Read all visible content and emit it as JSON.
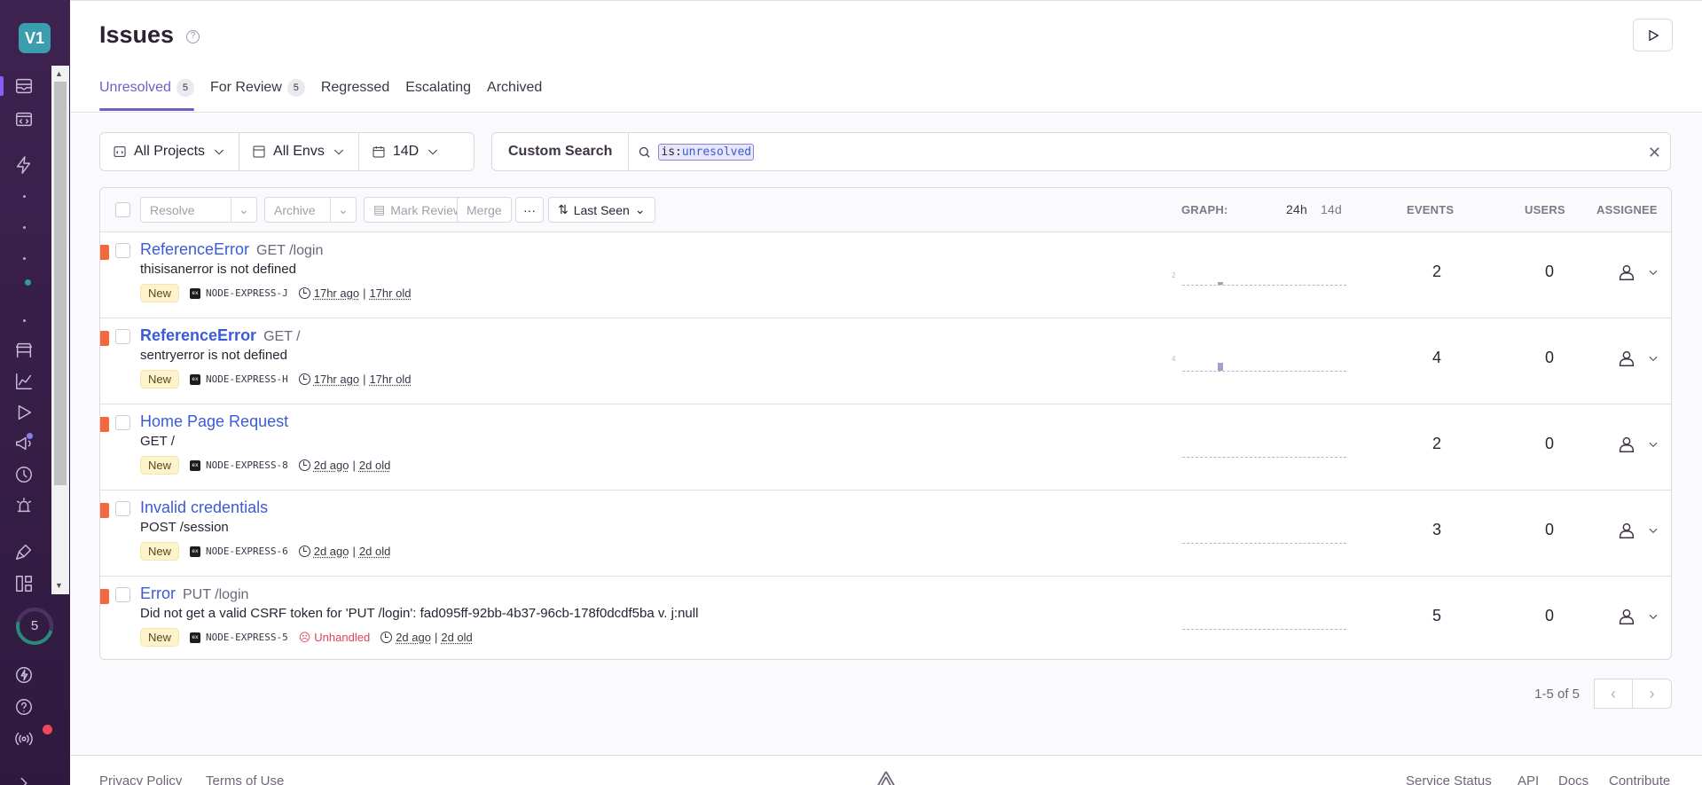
{
  "sidebar": {
    "org_initials": "V1",
    "onboarding_count": "5"
  },
  "header": {
    "title": "Issues",
    "tabs": [
      {
        "label": "Unresolved",
        "count": "5"
      },
      {
        "label": "For Review",
        "count": "5"
      },
      {
        "label": "Regressed"
      },
      {
        "label": "Escalating"
      },
      {
        "label": "Archived"
      }
    ]
  },
  "filters": {
    "projects": "All Projects",
    "envs": "All Envs",
    "period": "14D"
  },
  "search": {
    "custom_label": "Custom Search",
    "token_key": "is:",
    "token_value": "unresolved"
  },
  "toolbar": {
    "resolve": "Resolve",
    "archive": "Archive",
    "mark_reviewed": "Mark Reviewed",
    "merge": "Merge",
    "more": "···",
    "sort": "Last Seen",
    "graph_label": "GRAPH:",
    "graph_24h": "24h",
    "graph_14d": "14d",
    "events_header": "EVENTS",
    "users_header": "USERS",
    "assignee_header": "ASSIGNEE"
  },
  "issues": [
    {
      "title": "ReferenceError",
      "location": "GET /login",
      "message": "thisisanerror is not defined",
      "badge": "New",
      "project": "NODE-EXPRESS-J",
      "last_seen": "17hr ago",
      "age": "17hr old",
      "events": "2",
      "users": "0",
      "graph_max": "2"
    },
    {
      "title": "ReferenceError",
      "location": "GET /",
      "message": "sentryerror is not defined",
      "badge": "New",
      "project": "NODE-EXPRESS-H",
      "last_seen": "17hr ago",
      "age": "17hr old",
      "events": "4",
      "users": "0",
      "graph_max": "4"
    },
    {
      "title": "Home Page Request",
      "location": "",
      "message": "GET /",
      "badge": "New",
      "project": "NODE-EXPRESS-8",
      "last_seen": "2d ago",
      "age": "2d old",
      "events": "2",
      "users": "0"
    },
    {
      "title": "Invalid credentials",
      "location": "",
      "message": "POST /session",
      "badge": "New",
      "project": "NODE-EXPRESS-6",
      "last_seen": "2d ago",
      "age": "2d old",
      "events": "3",
      "users": "0"
    },
    {
      "title": "Error",
      "location": "PUT /login",
      "message": "Did not get a valid CSRF token for 'PUT /login': fad095ff-92bb-4b37-96cb-178f0dcdf5ba v. j:null",
      "badge": "New",
      "project": "NODE-EXPRESS-5",
      "unhandled": "Unhandled",
      "last_seen": "2d ago",
      "age": "2d old",
      "events": "5",
      "users": "0"
    }
  ],
  "pagination": {
    "text": "1-5 of 5"
  },
  "footer": {
    "privacy": "Privacy Policy",
    "terms": "Terms of Use",
    "status": "Service Status",
    "api": "API",
    "docs": "Docs",
    "contribute": "Contribute"
  }
}
